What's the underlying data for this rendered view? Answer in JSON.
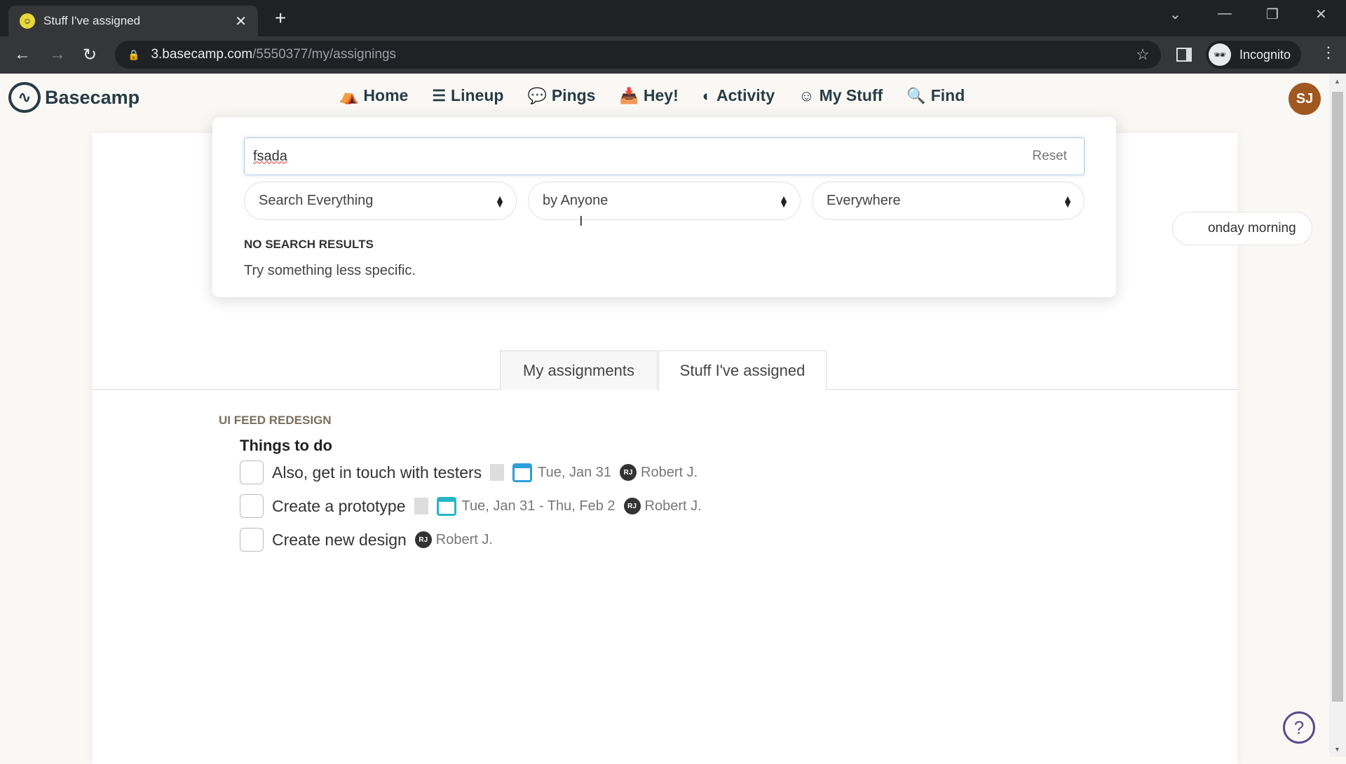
{
  "browser": {
    "tab_title": "Stuff I've assigned",
    "url_host": "3.basecamp.com",
    "url_path": "/5550377/my/assignings",
    "profile_label": "Incognito"
  },
  "app": {
    "brand": "Basecamp",
    "nav": [
      {
        "label": "Home",
        "icon": "home-icon"
      },
      {
        "label": "Lineup",
        "icon": "lineup-icon"
      },
      {
        "label": "Pings",
        "icon": "pings-icon"
      },
      {
        "label": "Hey!",
        "icon": "hey-inbox-icon"
      },
      {
        "label": "Activity",
        "icon": "activity-icon"
      },
      {
        "label": "My Stuff",
        "icon": "smiley-icon"
      },
      {
        "label": "Find",
        "icon": "search-icon"
      }
    ],
    "avatar_initials": "SJ",
    "avatar_color": "#a0581f"
  },
  "search": {
    "query": "fsada",
    "reset_label": "Reset",
    "filters": [
      "Search Everything",
      "by Anyone",
      "Everywhere"
    ],
    "no_results_title": "NO SEARCH RESULTS",
    "no_results_hint": "Try something less specific."
  },
  "page": {
    "schedule_pill": "onday morning",
    "tabs": [
      "My assignments",
      "Stuff I've assigned"
    ],
    "active_tab": "Stuff I've assigned",
    "project": "UI FEED REDESIGN",
    "list_title": "Things to do",
    "todos": [
      {
        "title": "Also, get in touch with testers",
        "has_notes": true,
        "date": "Tue, Jan 31",
        "assignee_initials": "RJ",
        "assignee": "Robert J."
      },
      {
        "title": "Create a prototype",
        "has_notes": true,
        "date": "Tue, Jan 31 - Thu, Feb 2",
        "assignee_initials": "RJ",
        "assignee": "Robert J."
      },
      {
        "title": "Create new design",
        "has_notes": false,
        "date": "",
        "assignee_initials": "RJ",
        "assignee": "Robert J."
      }
    ]
  }
}
